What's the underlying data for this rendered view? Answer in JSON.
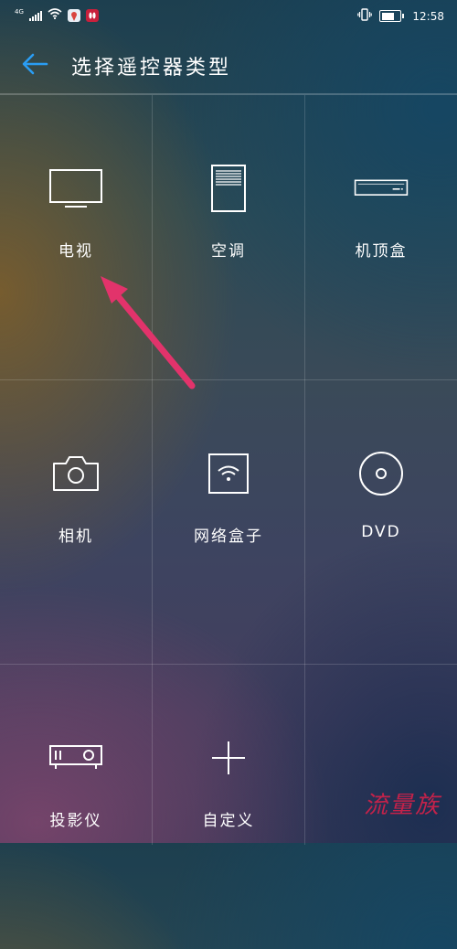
{
  "status_bar": {
    "network_tag": "4G",
    "time": "12:58",
    "icons": [
      "signal-icon",
      "wifi-icon",
      "location-app-icon",
      "huawei-app-icon",
      "vibrate-icon",
      "battery-icon"
    ]
  },
  "app_bar": {
    "back_icon": "back-arrow-icon",
    "title": "选择遥控器类型",
    "accent": "#2a9df4"
  },
  "devices": [
    {
      "label": "电视",
      "icon": "tv-icon"
    },
    {
      "label": "空调",
      "icon": "air-conditioner-icon"
    },
    {
      "label": "机顶盒",
      "icon": "set-top-box-icon"
    },
    {
      "label": "相机",
      "icon": "camera-icon"
    },
    {
      "label": "网络盒子",
      "icon": "network-box-icon"
    },
    {
      "label": "DVD",
      "icon": "dvd-icon"
    },
    {
      "label": "投影仪",
      "icon": "projector-icon"
    },
    {
      "label": "自定义",
      "icon": "plus-icon"
    }
  ],
  "annotation": {
    "arrow_color": "#e2336b",
    "points_to": "电视"
  },
  "watermark": {
    "text": "流量族",
    "color": "#c3224a"
  }
}
